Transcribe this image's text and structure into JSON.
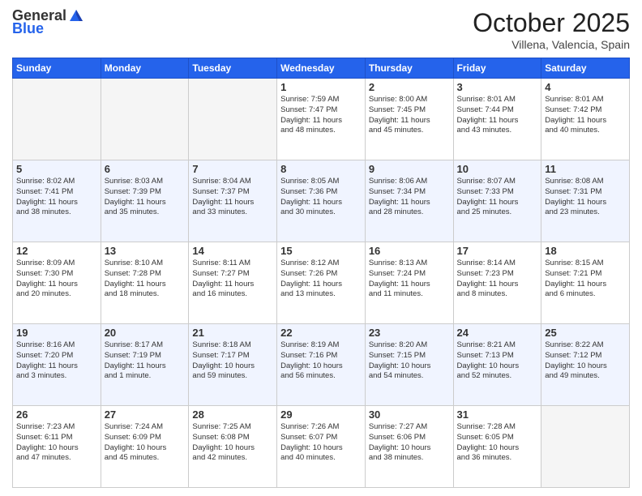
{
  "header": {
    "logo_general": "General",
    "logo_blue": "Blue",
    "month_title": "October 2025",
    "location": "Villena, Valencia, Spain"
  },
  "weekdays": [
    "Sunday",
    "Monday",
    "Tuesday",
    "Wednesday",
    "Thursday",
    "Friday",
    "Saturday"
  ],
  "weeks": [
    [
      {
        "day": "",
        "info": ""
      },
      {
        "day": "",
        "info": ""
      },
      {
        "day": "",
        "info": ""
      },
      {
        "day": "1",
        "info": "Sunrise: 7:59 AM\nSunset: 7:47 PM\nDaylight: 11 hours\nand 48 minutes."
      },
      {
        "day": "2",
        "info": "Sunrise: 8:00 AM\nSunset: 7:45 PM\nDaylight: 11 hours\nand 45 minutes."
      },
      {
        "day": "3",
        "info": "Sunrise: 8:01 AM\nSunset: 7:44 PM\nDaylight: 11 hours\nand 43 minutes."
      },
      {
        "day": "4",
        "info": "Sunrise: 8:01 AM\nSunset: 7:42 PM\nDaylight: 11 hours\nand 40 minutes."
      }
    ],
    [
      {
        "day": "5",
        "info": "Sunrise: 8:02 AM\nSunset: 7:41 PM\nDaylight: 11 hours\nand 38 minutes."
      },
      {
        "day": "6",
        "info": "Sunrise: 8:03 AM\nSunset: 7:39 PM\nDaylight: 11 hours\nand 35 minutes."
      },
      {
        "day": "7",
        "info": "Sunrise: 8:04 AM\nSunset: 7:37 PM\nDaylight: 11 hours\nand 33 minutes."
      },
      {
        "day": "8",
        "info": "Sunrise: 8:05 AM\nSunset: 7:36 PM\nDaylight: 11 hours\nand 30 minutes."
      },
      {
        "day": "9",
        "info": "Sunrise: 8:06 AM\nSunset: 7:34 PM\nDaylight: 11 hours\nand 28 minutes."
      },
      {
        "day": "10",
        "info": "Sunrise: 8:07 AM\nSunset: 7:33 PM\nDaylight: 11 hours\nand 25 minutes."
      },
      {
        "day": "11",
        "info": "Sunrise: 8:08 AM\nSunset: 7:31 PM\nDaylight: 11 hours\nand 23 minutes."
      }
    ],
    [
      {
        "day": "12",
        "info": "Sunrise: 8:09 AM\nSunset: 7:30 PM\nDaylight: 11 hours\nand 20 minutes."
      },
      {
        "day": "13",
        "info": "Sunrise: 8:10 AM\nSunset: 7:28 PM\nDaylight: 11 hours\nand 18 minutes."
      },
      {
        "day": "14",
        "info": "Sunrise: 8:11 AM\nSunset: 7:27 PM\nDaylight: 11 hours\nand 16 minutes."
      },
      {
        "day": "15",
        "info": "Sunrise: 8:12 AM\nSunset: 7:26 PM\nDaylight: 11 hours\nand 13 minutes."
      },
      {
        "day": "16",
        "info": "Sunrise: 8:13 AM\nSunset: 7:24 PM\nDaylight: 11 hours\nand 11 minutes."
      },
      {
        "day": "17",
        "info": "Sunrise: 8:14 AM\nSunset: 7:23 PM\nDaylight: 11 hours\nand 8 minutes."
      },
      {
        "day": "18",
        "info": "Sunrise: 8:15 AM\nSunset: 7:21 PM\nDaylight: 11 hours\nand 6 minutes."
      }
    ],
    [
      {
        "day": "19",
        "info": "Sunrise: 8:16 AM\nSunset: 7:20 PM\nDaylight: 11 hours\nand 3 minutes."
      },
      {
        "day": "20",
        "info": "Sunrise: 8:17 AM\nSunset: 7:19 PM\nDaylight: 11 hours\nand 1 minute."
      },
      {
        "day": "21",
        "info": "Sunrise: 8:18 AM\nSunset: 7:17 PM\nDaylight: 10 hours\nand 59 minutes."
      },
      {
        "day": "22",
        "info": "Sunrise: 8:19 AM\nSunset: 7:16 PM\nDaylight: 10 hours\nand 56 minutes."
      },
      {
        "day": "23",
        "info": "Sunrise: 8:20 AM\nSunset: 7:15 PM\nDaylight: 10 hours\nand 54 minutes."
      },
      {
        "day": "24",
        "info": "Sunrise: 8:21 AM\nSunset: 7:13 PM\nDaylight: 10 hours\nand 52 minutes."
      },
      {
        "day": "25",
        "info": "Sunrise: 8:22 AM\nSunset: 7:12 PM\nDaylight: 10 hours\nand 49 minutes."
      }
    ],
    [
      {
        "day": "26",
        "info": "Sunrise: 7:23 AM\nSunset: 6:11 PM\nDaylight: 10 hours\nand 47 minutes."
      },
      {
        "day": "27",
        "info": "Sunrise: 7:24 AM\nSunset: 6:09 PM\nDaylight: 10 hours\nand 45 minutes."
      },
      {
        "day": "28",
        "info": "Sunrise: 7:25 AM\nSunset: 6:08 PM\nDaylight: 10 hours\nand 42 minutes."
      },
      {
        "day": "29",
        "info": "Sunrise: 7:26 AM\nSunset: 6:07 PM\nDaylight: 10 hours\nand 40 minutes."
      },
      {
        "day": "30",
        "info": "Sunrise: 7:27 AM\nSunset: 6:06 PM\nDaylight: 10 hours\nand 38 minutes."
      },
      {
        "day": "31",
        "info": "Sunrise: 7:28 AM\nSunset: 6:05 PM\nDaylight: 10 hours\nand 36 minutes."
      },
      {
        "day": "",
        "info": ""
      }
    ]
  ]
}
